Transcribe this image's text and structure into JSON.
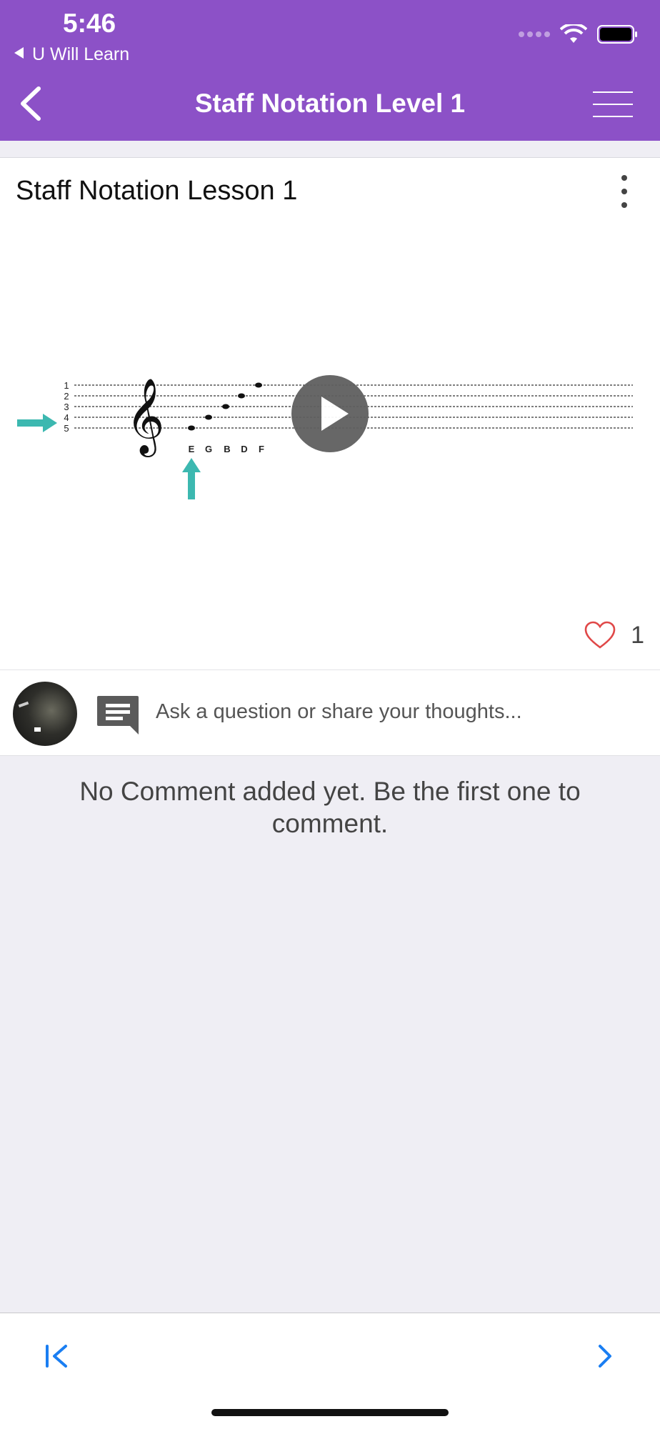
{
  "status_bar": {
    "time": "5:46",
    "back_app": "U Will Learn"
  },
  "nav": {
    "title": "Staff Notation Level 1",
    "back_icon": "chevron-left-icon",
    "menu_icon": "hamburger-menu-icon"
  },
  "lesson": {
    "title": "Staff Notation Lesson 1",
    "staff_line_numbers": [
      "1",
      "2",
      "3",
      "4",
      "5"
    ],
    "note_letters": [
      "E",
      "G",
      "B",
      "D",
      "F"
    ],
    "likes": "1"
  },
  "comments": {
    "placeholder": "Ask a question or share your thoughts...",
    "empty_message": "No Comment added yet. Be the first one to comment."
  },
  "colors": {
    "header": "#8c51c7",
    "arrow": "#3cb8b0",
    "link": "#1a7ef2",
    "heart": "#e04848"
  }
}
